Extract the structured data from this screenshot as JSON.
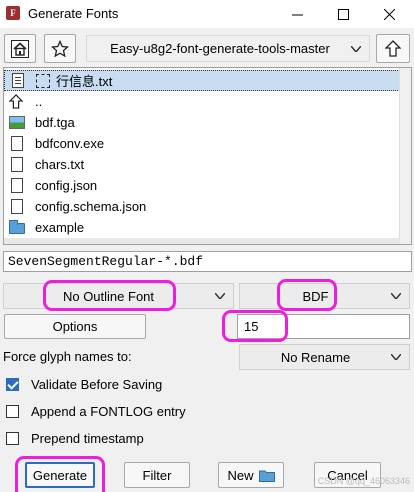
{
  "window": {
    "title": "Generate Fonts",
    "app_icon_glyph": "F",
    "minimize_icon": "minimize-icon",
    "maximize_icon": "maximize-icon",
    "close_icon": "close-icon"
  },
  "toolbar": {
    "home_icon": "home-icon",
    "bookmark_icon": "star-icon",
    "directory": "Easy-u8g2-font-generate-tools-master",
    "up_icon": "up-arrow-icon"
  },
  "files": [
    {
      "name": "行信息.txt",
      "icon": "text-file-icon",
      "selected": true
    },
    {
      "name": "..",
      "icon": "up-arrow-icon",
      "selected": false
    },
    {
      "name": "bdf.tga",
      "icon": "image-file-icon",
      "selected": false
    },
    {
      "name": "bdfconv.exe",
      "icon": "file-icon",
      "selected": false
    },
    {
      "name": "chars.txt",
      "icon": "file-icon",
      "selected": false
    },
    {
      "name": "config.json",
      "icon": "file-icon",
      "selected": false
    },
    {
      "name": "config.schema.json",
      "icon": "file-icon",
      "selected": false
    },
    {
      "name": "example",
      "icon": "folder-icon",
      "selected": false
    }
  ],
  "filename": "SevenSegmentRegular-*.bdf",
  "outline_font": "No Outline Font",
  "bitmap_format": "BDF",
  "options_label": "Options",
  "pixel_size": "15",
  "force_glyph_label": "Force glyph names to:",
  "force_glyph_value": "No Rename",
  "checks": [
    {
      "label": "Validate Before Saving",
      "checked": true
    },
    {
      "label": "Append a FONTLOG entry",
      "checked": false
    },
    {
      "label": "Prepend timestamp",
      "checked": false
    }
  ],
  "buttons": {
    "generate": "Generate",
    "filter": "Filter",
    "new": "New",
    "cancel": "Cancel"
  },
  "watermark": "CSDN @qq_46063346",
  "highlight_color": "#ee1ee0",
  "selection_color": "#c8ddf2"
}
